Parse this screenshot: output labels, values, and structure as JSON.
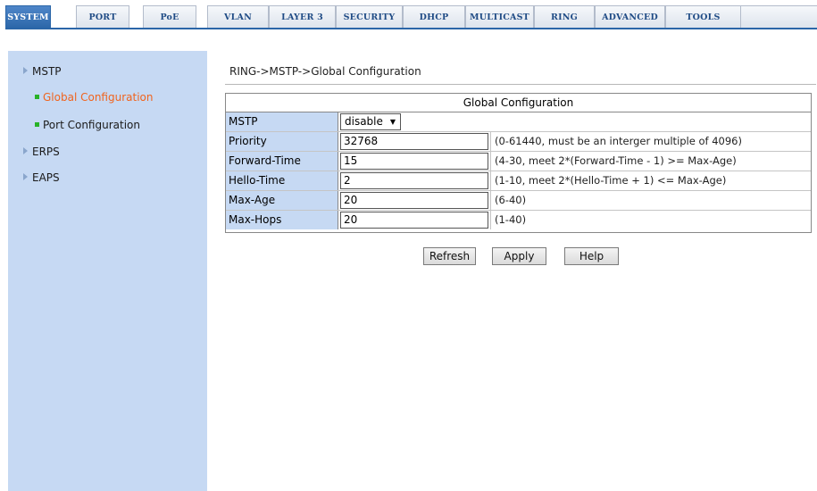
{
  "tabs": [
    {
      "label": "SYSTEM",
      "active": true
    },
    {
      "label": "PORT",
      "active": false
    },
    {
      "label": "PoE",
      "active": false
    },
    {
      "label": "VLAN",
      "active": false
    },
    {
      "label": "LAYER 3",
      "active": false
    },
    {
      "label": "SECURITY",
      "active": false
    },
    {
      "label": "DHCP",
      "active": false
    },
    {
      "label": "MULTICAST",
      "active": false
    },
    {
      "label": "RING",
      "active": false
    },
    {
      "label": "ADVANCED",
      "active": false
    },
    {
      "label": "TOOLS",
      "active": false
    }
  ],
  "sidebar": {
    "items": [
      {
        "label": "MSTP",
        "type": "group"
      },
      {
        "label": "Global Configuration",
        "type": "link",
        "current": true
      },
      {
        "label": "Port Configuration",
        "type": "link",
        "current": false
      },
      {
        "label": "ERPS",
        "type": "group"
      },
      {
        "label": "EAPS",
        "type": "group"
      }
    ]
  },
  "breadcrumb": "RING->MSTP->Global Configuration",
  "table": {
    "title": "Global Configuration",
    "rows": [
      {
        "label": "MSTP",
        "value": "disable",
        "hint": ""
      },
      {
        "label": "Priority",
        "value": "32768",
        "hint": "(0-61440, must be an interger multiple of 4096)"
      },
      {
        "label": "Forward-Time",
        "value": "15",
        "hint": "(4-30, meet 2*(Forward-Time - 1) >= Max-Age)"
      },
      {
        "label": "Hello-Time",
        "value": "2",
        "hint": "(1-10,  meet 2*(Hello-Time + 1) <= Max-Age)"
      },
      {
        "label": "Max-Age",
        "value": "20",
        "hint": "(6-40)"
      },
      {
        "label": "Max-Hops",
        "value": "20",
        "hint": "(1-40)"
      }
    ]
  },
  "buttons": {
    "refresh": "Refresh",
    "apply": "Apply",
    "help": "Help"
  },
  "colors": {
    "tab_active": "#2b66a8",
    "sidebar_bg": "#c6d9f3",
    "label_bg": "#c6d9f3",
    "current_link": "#f0641e"
  }
}
